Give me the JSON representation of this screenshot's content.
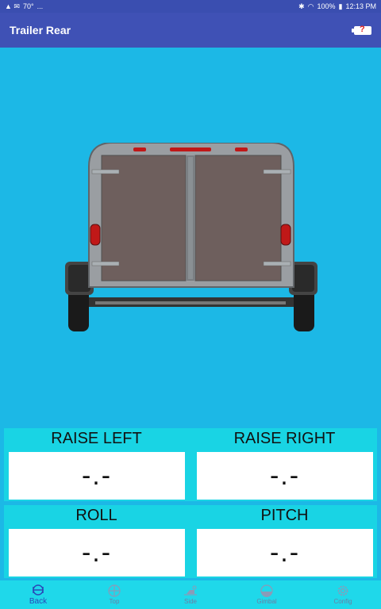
{
  "statusbar": {
    "left_icons": "▲ ✉ ",
    "temp": "70°",
    "dots": "...",
    "battery": "100%",
    "time": "12:13 PM"
  },
  "appbar": {
    "title": "Trailer Rear",
    "battery_icon": "battery-unknown-icon",
    "battery_mark": "?"
  },
  "readings": {
    "raise_left": {
      "label": "RAISE LEFT",
      "value": "-.-"
    },
    "raise_right": {
      "label": "RAISE RIGHT",
      "value": "-.-"
    },
    "roll": {
      "label": "ROLL",
      "value": "-.-"
    },
    "pitch": {
      "label": "PITCH",
      "value": "-.-"
    }
  },
  "nav": {
    "items": [
      {
        "label": "Back",
        "icon": "back-view-icon",
        "active": true
      },
      {
        "label": "Top",
        "icon": "top-view-icon",
        "active": false
      },
      {
        "label": "Side",
        "icon": "side-view-icon",
        "active": false
      },
      {
        "label": "Gimbal",
        "icon": "gimbal-icon",
        "active": false
      },
      {
        "label": "Config",
        "icon": "gear-icon",
        "active": false
      }
    ]
  },
  "colors": {
    "background": "#1cb8e6",
    "appbar": "#3f51b5",
    "panel": "#19d4e4",
    "nav_active": "#2a4ab8"
  }
}
